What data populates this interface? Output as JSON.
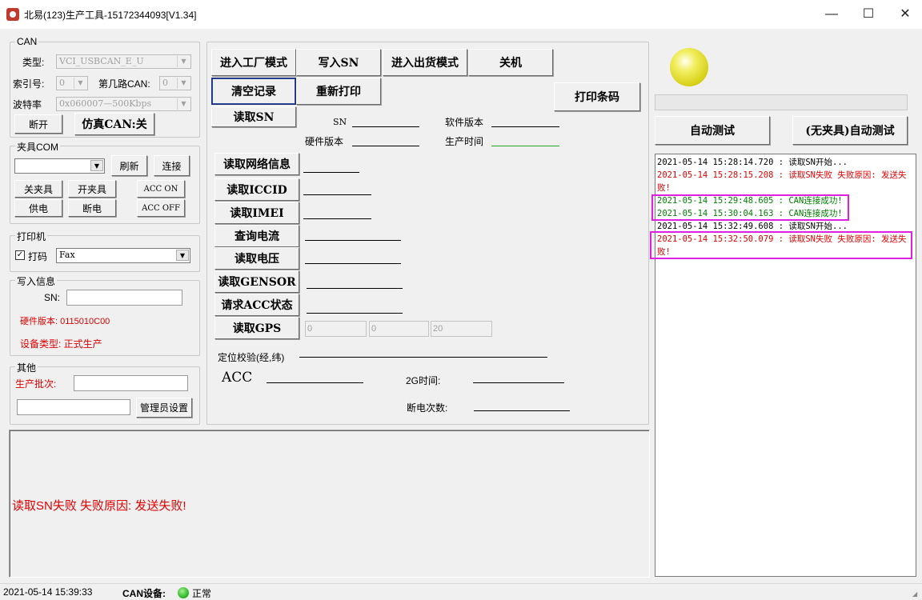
{
  "window": {
    "title": "北易(123)生产工具-15172344093[V1.34]",
    "minimize": "—",
    "maximize": "☐",
    "close": "✕"
  },
  "can": {
    "title": "CAN",
    "type_label": "类型:",
    "type_value": "VCI_USBCAN_E_U",
    "index_label": "索引号:",
    "index_value": "0",
    "channel_label": "第几路CAN:",
    "channel_value": "0",
    "baud_label": "波特率",
    "baud_value": "0x060007—500Kbps",
    "disconnect_btn": "断开",
    "sim_btn": "仿真CAN:关"
  },
  "fixture": {
    "title": "夹具COM",
    "com_value": "",
    "refresh_btn": "刷新",
    "connect_btn": "连接",
    "close_btn": "关夹具",
    "open_btn": "开夹具",
    "acc_on_btn": "ACC ON",
    "power_btn": "供电",
    "cut_btn": "断电",
    "acc_off_btn": "ACC OFF"
  },
  "printer": {
    "title": "打印机",
    "print_label": "打码",
    "print_checked": true,
    "printer_value": "Fax"
  },
  "write_info": {
    "title": "写入信息",
    "sn_label": "SN:",
    "sn_value": "",
    "hw_version": "硬件版本: 0115010C00",
    "device_type": "设备类型: 正式生产"
  },
  "other": {
    "title": "其他",
    "batch_label": "生产批次:",
    "batch_value": "",
    "admin_value": "",
    "admin_btn": "管理员设置"
  },
  "main": {
    "enter_factory_btn": "进入工厂模式",
    "write_sn_btn": "写入SN",
    "enter_ship_btn": "进入出货模式",
    "shutdown_btn": "关机",
    "clear_log_btn": "清空记录",
    "reprint_btn": "重新打印",
    "print_barcode_btn": "打印条码",
    "read_sn_btn": "读取SN",
    "sn_label": "SN",
    "sw_version_label": "软件版本",
    "hw_version_label": "硬件版本",
    "prod_time_label": "生产时间",
    "read_net_btn": "读取网络信息",
    "read_iccid_btn": "读取ICCID",
    "read_imei_btn": "读取IMEI",
    "query_current_btn": "查询电流",
    "read_voltage_btn": "读取电压",
    "read_gsensor_btn": "读取GENSOR",
    "request_acc_btn": "请求ACC状态",
    "read_gps_btn": "读取GPS",
    "gps_values": [
      "0",
      "0",
      "20"
    ],
    "locate_label": "定位校验(经,纬)",
    "acc_label": "ACC",
    "g2_time_label": "2G时间:",
    "power_off_count_label": "断电次数:"
  },
  "status_panel": {
    "message": "读取SN失败 失败原因: 发送失败!"
  },
  "right": {
    "auto_test_btn": "自动测试",
    "auto_test_nofix_btn": "(无夹具)自动测试",
    "indicator_color": "#e8e020"
  },
  "log": [
    {
      "text": "2021-05-14 15:28:14.720 : 读取SN开始...",
      "color": "#000000"
    },
    {
      "text": "2021-05-14 15:28:15.208 : 读取SN失败 失败原因: 发送失",
      "color": "#e00000"
    },
    {
      "text": "败!",
      "color": "#e00000"
    },
    {
      "text": "2021-05-14 15:29:48.605 : CAN连接成功!",
      "color": "#008000"
    },
    {
      "text": "2021-05-14 15:30:04.163 : CAN连接成功!",
      "color": "#008000"
    },
    {
      "text": "2021-05-14 15:32:49.608 : 读取SN开始...",
      "color": "#000000"
    },
    {
      "text": "2021-05-14 15:32:50.079 : 读取SN失败 失败原因: 发送失",
      "color": "#e00000"
    },
    {
      "text": "败!",
      "color": "#e00000"
    }
  ],
  "statusbar": {
    "datetime": "2021-05-14 15:39:33",
    "can_device_label": "CAN设备:",
    "can_device_status": "正常",
    "status_color": "#22b020"
  }
}
